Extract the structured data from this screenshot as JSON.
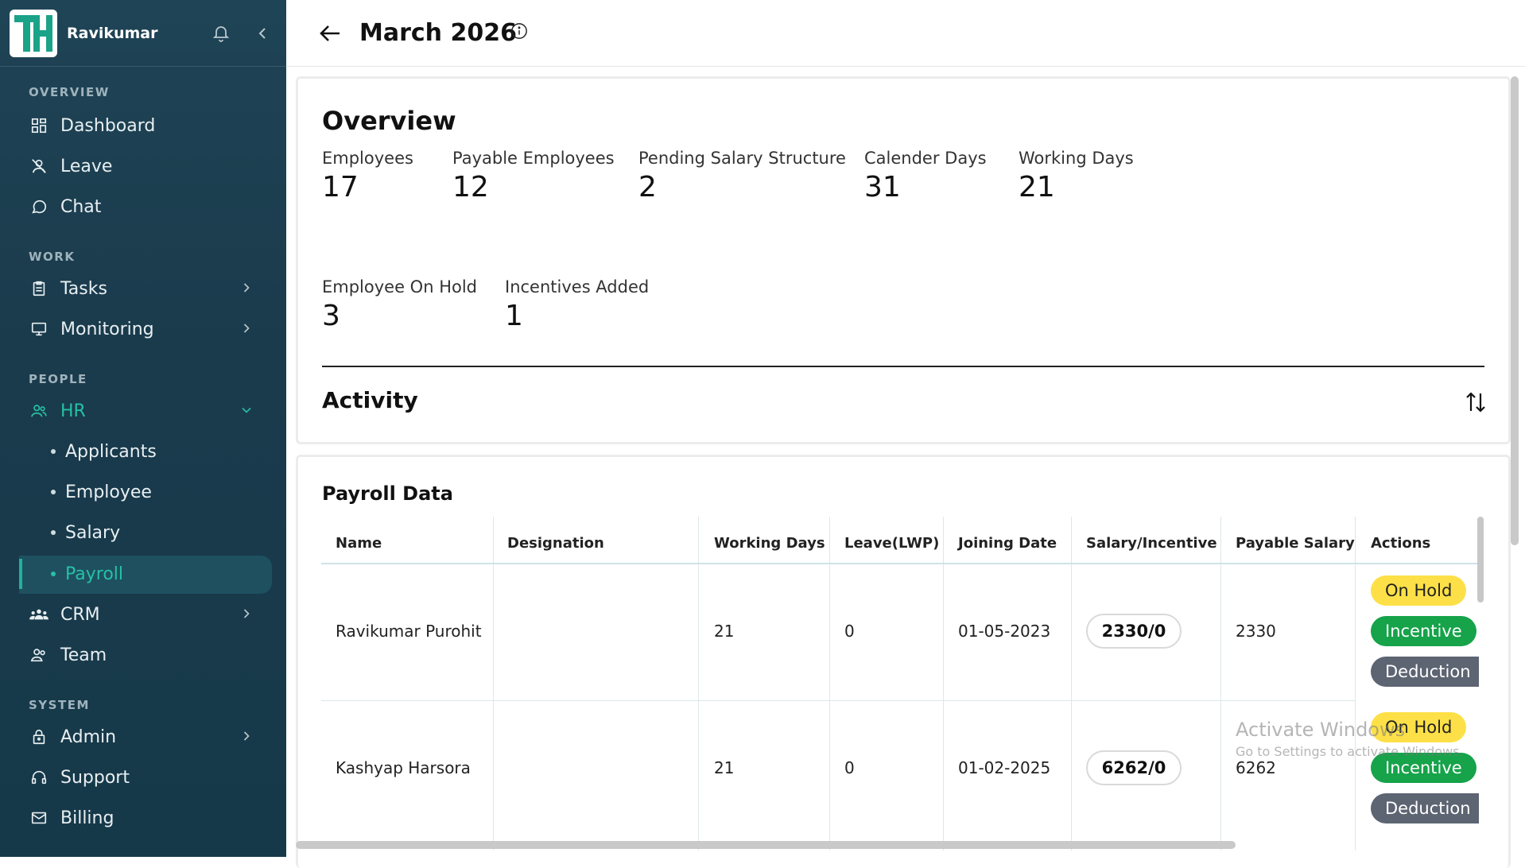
{
  "sidebar": {
    "user": "Ravikumar",
    "sections": {
      "overview": "OVERVIEW",
      "work": "WORK",
      "people": "PEOPLE",
      "system": "SYSTEM"
    },
    "items": {
      "dashboard": "Dashboard",
      "leave": "Leave",
      "chat": "Chat",
      "tasks": "Tasks",
      "monitoring": "Monitoring",
      "hr": "HR",
      "applicants": "Applicants",
      "employee": "Employee",
      "salary": "Salary",
      "payroll": "Payroll",
      "crm": "CRM",
      "team": "Team",
      "admin": "Admin",
      "support": "Support",
      "billing": "Billing"
    }
  },
  "header": {
    "title": "March 2026"
  },
  "overview": {
    "title": "Overview",
    "stats": [
      {
        "label": "Employees",
        "value": "17"
      },
      {
        "label": "Payable Employees",
        "value": "12"
      },
      {
        "label": "Pending Salary Structure",
        "value": "2"
      },
      {
        "label": "Calender Days",
        "value": "31"
      },
      {
        "label": "Working Days",
        "value": "21"
      },
      {
        "label": "Employee On Hold",
        "value": "3"
      },
      {
        "label": "Incentives Added",
        "value": "1"
      }
    ],
    "activity": "Activity"
  },
  "payroll": {
    "title": "Payroll Data",
    "columns": [
      "Name",
      "Designation",
      "Working Days",
      "Leave(LWP)",
      "Joining Date",
      "Salary/Incentive",
      "Payable Salary",
      "Actions"
    ],
    "rows": [
      {
        "name": "Ravikumar Purohit",
        "designation": "",
        "working_days": "21",
        "leave": "0",
        "joining": "01-05-2023",
        "salary_incentive": "2330/0",
        "payable": "2330"
      },
      {
        "name": "Kashyap Harsora",
        "designation": "",
        "working_days": "21",
        "leave": "0",
        "joining": "01-02-2025",
        "salary_incentive": "6262/0",
        "payable": "6262"
      }
    ],
    "actions": {
      "hold": "On Hold",
      "incentive": "Incentive",
      "deduction": "Deduction"
    }
  },
  "watermark": {
    "line1": "Activate Windows",
    "line2": "Go to Settings to activate Windows."
  },
  "colors": {
    "sidebar_bg": "#1f4456",
    "accent": "#27c0a4",
    "hold": "#fde047",
    "incentive": "#16a34a",
    "deduction": "#5d6472"
  }
}
